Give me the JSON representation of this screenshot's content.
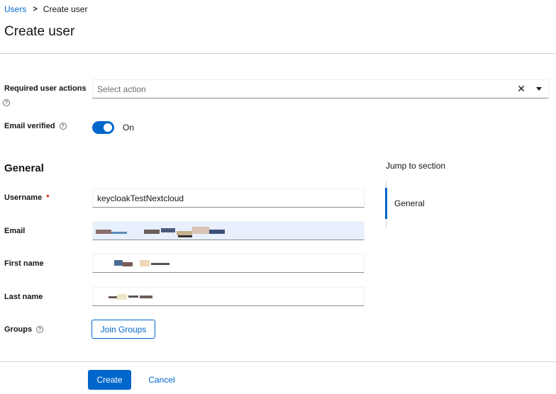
{
  "breadcrumb": {
    "parent": "Users",
    "separator": ">",
    "current": "Create user"
  },
  "page_title": "Create user",
  "required_actions": {
    "label": "Required user actions",
    "placeholder": "Select action",
    "clear_glyph": "✕"
  },
  "email_verified": {
    "label": "Email verified",
    "state_label": "On",
    "enabled": true
  },
  "general": {
    "title": "General"
  },
  "fields": {
    "username": {
      "label": "Username",
      "required_mark": "*",
      "value": "keycloakTestNextcloud"
    },
    "email": {
      "label": "Email"
    },
    "first_name": {
      "label": "First name"
    },
    "last_name": {
      "label": "Last name"
    },
    "groups": {
      "label": "Groups",
      "button": "Join Groups"
    }
  },
  "footer": {
    "create": "Create",
    "cancel": "Cancel"
  },
  "jump_to_section": {
    "title": "Jump to section",
    "items": [
      "General"
    ]
  },
  "icons": {
    "help": "help-circle-icon",
    "clear": "close-icon",
    "caret": "caret-down-icon"
  },
  "colors": {
    "primary": "#0066cc",
    "required": "#c9190b",
    "autofill_bg": "#e8f0fe"
  }
}
